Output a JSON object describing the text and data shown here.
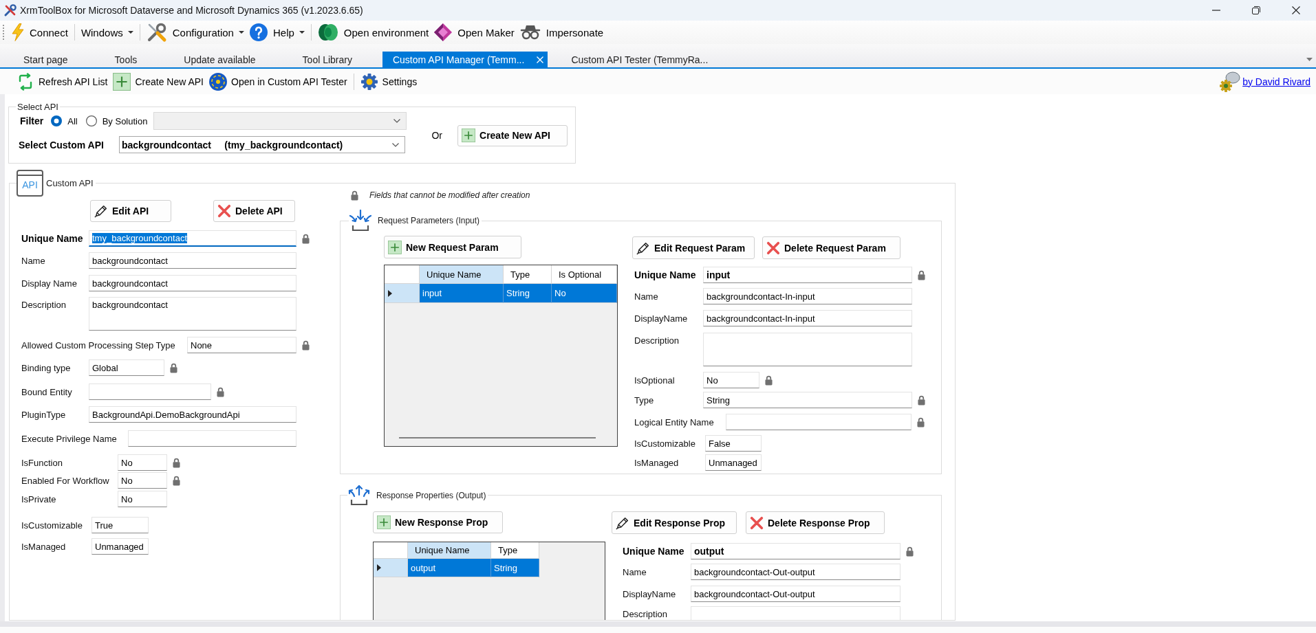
{
  "window": {
    "title": "XrmToolBox for Microsoft Dataverse and Microsoft Dynamics 365 (v1.2023.6.65)"
  },
  "toolbar": [
    {
      "kind": "button",
      "label": "Connect"
    },
    {
      "kind": "separator"
    },
    {
      "kind": "dropdown",
      "label": "Windows"
    },
    {
      "kind": "separator"
    },
    {
      "kind": "dropdown",
      "label": "Configuration"
    },
    {
      "kind": "dropdown",
      "label": "Help"
    },
    {
      "kind": "separator"
    },
    {
      "kind": "button",
      "label": "Open environment"
    },
    {
      "kind": "button",
      "label": "Open Maker"
    },
    {
      "kind": "button",
      "label": "Impersonate"
    }
  ],
  "tabs": [
    {
      "label": "Start page",
      "selected": false
    },
    {
      "label": "Tools",
      "selected": false
    },
    {
      "label": "Update available",
      "selected": false
    },
    {
      "label": "Tool Library",
      "selected": false
    },
    {
      "label": "Custom API Manager (Temm...",
      "selected": true
    },
    {
      "label": "Custom API Tester (TemmyRa...",
      "selected": false
    }
  ],
  "tool_toolbar": {
    "items": [
      {
        "kind": "button",
        "label": "Refresh API List"
      },
      {
        "kind": "button",
        "label": "Create New API"
      },
      {
        "kind": "button",
        "label": "Open in Custom API Tester"
      },
      {
        "kind": "separator"
      },
      {
        "kind": "button",
        "label": "Settings"
      }
    ],
    "author_link": "by David Rivard"
  },
  "select_api": {
    "title": "Select API",
    "filter_label": "Filter",
    "filter_options": [
      {
        "label": "All",
        "selected": true
      },
      {
        "label": "By Solution",
        "selected": false
      }
    ],
    "solution_disabled": true,
    "custom_api_label": "Select Custom API",
    "custom_api_value": "backgroundcontact     (tmy_backgroundcontact)",
    "or_label": "Or",
    "create_button": "Create New API"
  },
  "custom_api": {
    "title": "Custom API",
    "icon_text": "API",
    "edit_button": "Edit API",
    "delete_button": "Delete API",
    "fields": [
      {
        "label": "Unique Name",
        "value": "tmy_backgroundcontact",
        "kind": "key",
        "locked": true,
        "focused": true
      },
      {
        "label": "Name",
        "value": "backgroundcontact",
        "kind": "text",
        "locked": false,
        "focused": false
      },
      {
        "label": "Display Name",
        "value": "backgroundcontact",
        "kind": "text",
        "locked": false,
        "focused": false
      },
      {
        "label": "Description",
        "value": "backgroundcontact",
        "kind": "multiline",
        "locked": false,
        "focused": false
      },
      {
        "label": "Allowed Custom Processing Step Type",
        "value": "None",
        "kind": "text",
        "locked": true,
        "focused": false
      },
      {
        "label": "Binding type",
        "value": "Global",
        "kind": "text",
        "locked": true,
        "focused": false
      },
      {
        "label": "Bound Entity",
        "kind": "text",
        "locked": true,
        "focused": false
      },
      {
        "label": "PluginType",
        "value": "BackgroundApi.DemoBackgroundApi",
        "kind": "text",
        "locked": false,
        "focused": false
      },
      {
        "label": "Execute Privilege Name",
        "kind": "text",
        "locked": false,
        "focused": false
      },
      {
        "label": "IsFunction",
        "value": "No",
        "kind": "text",
        "locked": true,
        "focused": false
      },
      {
        "label": "Enabled For Workflow",
        "value": "No",
        "kind": "text",
        "locked": true,
        "focused": false
      },
      {
        "label": "IsPrivate",
        "value": "No",
        "kind": "text",
        "locked": false,
        "focused": false
      },
      {
        "label": "IsCustomizable",
        "value": "True",
        "kind": "text",
        "locked": false,
        "focused": false
      },
      {
        "label": "IsManaged",
        "value": "Unmanaged",
        "kind": "text",
        "locked": false,
        "focused": false
      }
    ]
  },
  "locked_note": "Fields that cannot be modified after creation",
  "request_parameters": {
    "title": "Request Parameters (Input)",
    "new_button": "New Request Param",
    "edit_button": "Edit Request Param",
    "delete_button": "Delete Request Param",
    "table": {
      "columns": [
        {
          "label": "Unique Name",
          "selected": true
        },
        {
          "label": "Type",
          "selected": false
        },
        {
          "label": "Is Optional",
          "selected": false
        }
      ],
      "rows": [
        {
          "cells": [
            "input",
            "String",
            "No"
          ],
          "selected": true
        }
      ]
    },
    "fields": [
      {
        "label": "Unique Name",
        "value": "input",
        "kind": "key",
        "locked": true
      },
      {
        "label": "Name",
        "value": "backgroundcontact-In-input",
        "kind": "text",
        "locked": false
      },
      {
        "label": "DisplayName",
        "value": "backgroundcontact-In-input",
        "kind": "text",
        "locked": false
      },
      {
        "label": "Description",
        "kind": "multiline",
        "locked": false
      },
      {
        "label": "IsOptional",
        "value": "No",
        "kind": "text",
        "locked": true
      },
      {
        "label": "Type",
        "value": "String",
        "kind": "text",
        "locked": true
      },
      {
        "label": "Logical Entity Name",
        "kind": "text",
        "locked": true
      },
      {
        "label": "IsCustomizable",
        "value": "False",
        "kind": "text",
        "locked": false
      },
      {
        "label": "IsManaged",
        "value": "Unmanaged",
        "kind": "text",
        "locked": false
      }
    ]
  },
  "response_properties": {
    "title": "Response Properties (Output)",
    "new_button": "New Response Prop",
    "edit_button": "Edit Response Prop",
    "delete_button": "Delete Response Prop",
    "table": {
      "columns": [
        {
          "label": "Unique Name",
          "selected": true
        },
        {
          "label": "Type",
          "selected": false
        }
      ],
      "rows": [
        {
          "cells": [
            "output",
            "String"
          ],
          "selected": true
        }
      ]
    },
    "fields": [
      {
        "label": "Unique Name",
        "value": "output",
        "kind": "key",
        "locked": true
      },
      {
        "label": "Name",
        "value": "backgroundcontact-Out-output",
        "kind": "text",
        "locked": false
      },
      {
        "label": "DisplayName",
        "value": "backgroundcontact-Out-output",
        "kind": "text",
        "locked": false
      },
      {
        "label": "Description",
        "kind": "multiline",
        "locked": false
      }
    ]
  }
}
